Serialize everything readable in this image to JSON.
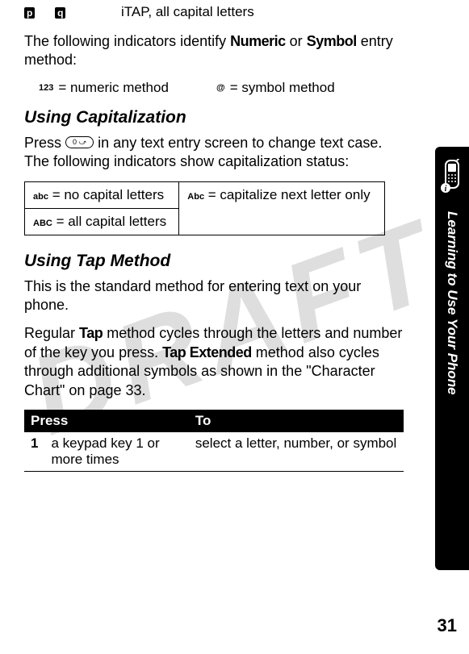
{
  "watermark": "DRAFT",
  "itap_row": {
    "text": "iTAP, all capital letters"
  },
  "intro_line1": "The following indicators identify ",
  "intro_bold1": "Numeric",
  "intro_mid": " or ",
  "intro_bold2": "Symbol",
  "intro_line2": " entry method:",
  "methods": {
    "numeric": {
      "icon": "123",
      "label": "= numeric method"
    },
    "symbol": {
      "icon": "@",
      "label": "= symbol method"
    }
  },
  "section_cap": {
    "title": "Using Capitalization",
    "press_pre": "Press ",
    "key": "0",
    "press_post": " in any text entry screen to change text case. The following indicators show capitalization status:"
  },
  "cap_table": {
    "r1c1_icon": "abc",
    "r1c1_text": " = no capital letters",
    "r2c1_icon": "ABC",
    "r2c1_text": " = all capital letters",
    "r1c2_icon": "Abc",
    "r1c2_text": " = capitalize next letter only"
  },
  "section_tap": {
    "title": "Using Tap Method",
    "p1": "This is the standard method for entering text on your phone.",
    "p2_pre": "Regular ",
    "p2_b1": "Tap",
    "p2_mid1": " method cycles through the letters and number of the key you press. ",
    "p2_b2": "Tap Extended",
    "p2_mid2": " method also cycles through additional symbols as shown in the \"Character Chart\" on page 33."
  },
  "press_table": {
    "h1": "Press",
    "h2": "To",
    "r1_num": "1",
    "r1_press": "a keypad key 1 or more times",
    "r1_to": "select a letter, number, or symbol"
  },
  "side_label": "Learning to Use Your Phone",
  "page_number": "31"
}
